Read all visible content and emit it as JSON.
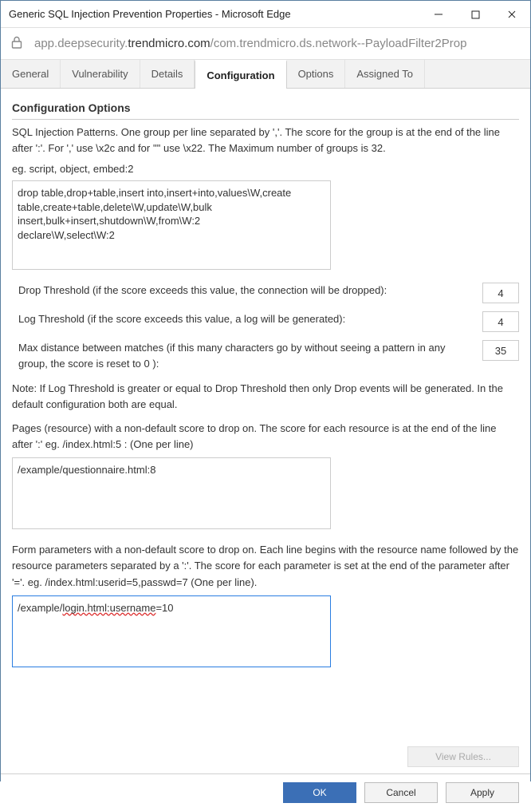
{
  "window": {
    "title": "Generic SQL Injection Prevention Properties - Microsoft Edge"
  },
  "address": {
    "host_pre": "app.deepsecurity.",
    "host_bold": "trendmicro.com",
    "path": "/com.trendmicro.ds.network--PayloadFilter2Prop"
  },
  "tabs": {
    "general": "General",
    "vulnerability": "Vulnerability",
    "details": "Details",
    "configuration": "Configuration",
    "options": "Options",
    "assigned": "Assigned To"
  },
  "config": {
    "heading": "Configuration Options",
    "patterns_desc": "SQL Injection Patterns. One group per line separated by ','. The score for the group is at the end of the line after ':'. For ',' use \\x2c and for '\"' use \\x22. The Maximum number of groups is 32.",
    "patterns_eg": "eg. script, object, embed:2",
    "patterns_value": "drop table,drop+table,insert into,insert+into,values\\W,create table,create+table,delete\\W,update\\W,bulk insert,bulk+insert,shutdown\\W,from\\W:2\ndeclare\\W,select\\W:2",
    "drop_threshold_label": "Drop Threshold (if the score exceeds this value, the connection will be dropped):",
    "drop_threshold_value": "4",
    "log_threshold_label": "Log Threshold (if the score exceeds this value, a log will be generated):",
    "log_threshold_value": "4",
    "max_distance_label": "Max distance between matches (if this many characters go by without seeing a pattern in any group, the score is reset to 0 ):",
    "max_distance_value": "35",
    "note": "Note: If Log Threshold is greater or equal to Drop Threshold then only Drop events will be generated. In the default configuration both are equal.",
    "pages_desc": "Pages (resource) with a non-default score to drop on. The score for each resource is at the end of the line after ':' eg. /index.html:5 : (One per line)",
    "pages_value": "/example/questionnaire.html:8",
    "params_desc": "Form parameters with a non-default score to drop on. Each line begins with the resource name followed by the resource parameters separated by a ':'. The score for each parameter is set at the end of the parameter after '='. eg. /index.html:userid=5,passwd=7 (One per line).",
    "params_value_pre": "/example/",
    "params_value_spell": "login.html:username",
    "params_value_post": "=10",
    "view_rules": "View Rules..."
  },
  "footer": {
    "ok": "OK",
    "cancel": "Cancel",
    "apply": "Apply"
  }
}
